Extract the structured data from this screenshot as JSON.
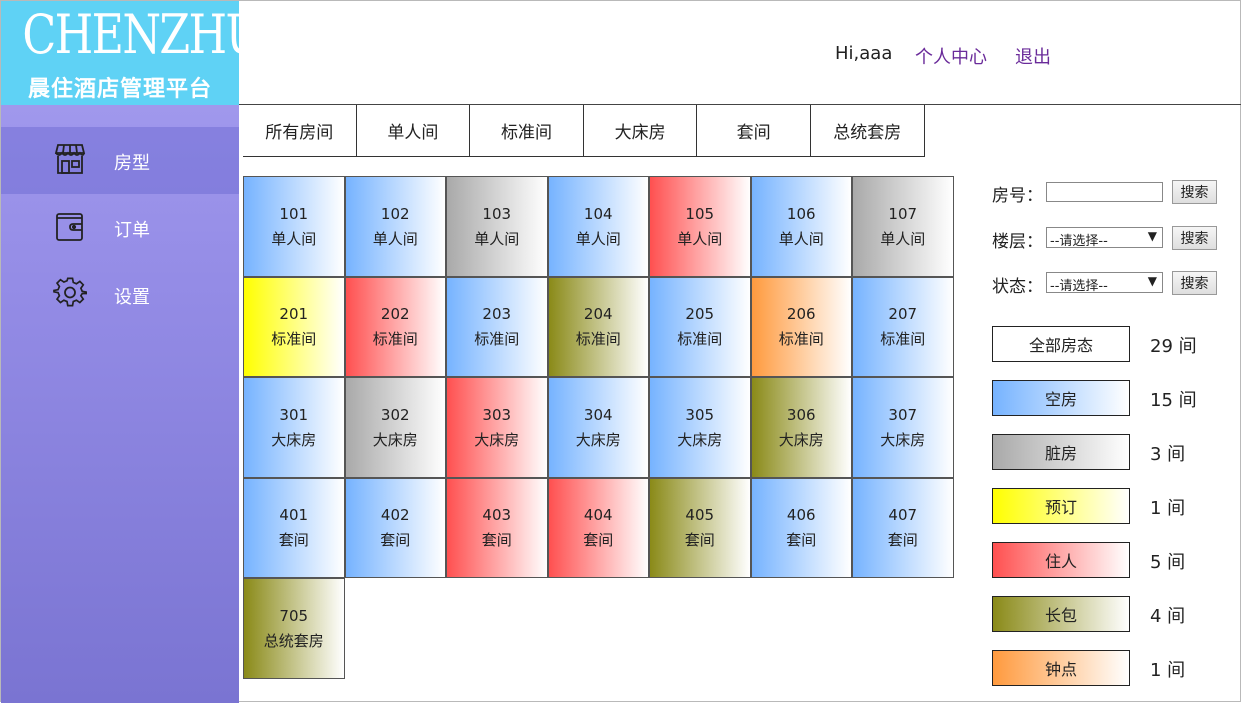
{
  "logo": {
    "title": "CHENZHU",
    "subtitle": "晨住酒店管理平台"
  },
  "sidebar": {
    "items": [
      {
        "label": "房型",
        "icon": "storefront-icon",
        "active": true
      },
      {
        "label": "订单",
        "icon": "wallet-icon",
        "active": false
      },
      {
        "label": "设置",
        "icon": "gear-icon",
        "active": false
      }
    ]
  },
  "header": {
    "greeting": "Hi,aaa",
    "profile_link": "个人中心",
    "logout_link": "退出"
  },
  "tabs": [
    "所有房间",
    "单人间",
    "标准间",
    "大床房",
    "套间",
    "总统套房"
  ],
  "rooms": [
    {
      "num": "101",
      "type": "单人间",
      "status": "empty"
    },
    {
      "num": "102",
      "type": "单人间",
      "status": "empty"
    },
    {
      "num": "103",
      "type": "单人间",
      "status": "dirty"
    },
    {
      "num": "104",
      "type": "单人间",
      "status": "empty"
    },
    {
      "num": "105",
      "type": "单人间",
      "status": "live"
    },
    {
      "num": "106",
      "type": "单人间",
      "status": "empty"
    },
    {
      "num": "107",
      "type": "单人间",
      "status": "dirty"
    },
    {
      "num": "201",
      "type": "标准间",
      "status": "booked"
    },
    {
      "num": "202",
      "type": "标准间",
      "status": "live"
    },
    {
      "num": "203",
      "type": "标准间",
      "status": "empty"
    },
    {
      "num": "204",
      "type": "标准间",
      "status": "long"
    },
    {
      "num": "205",
      "type": "标准间",
      "status": "empty"
    },
    {
      "num": "206",
      "type": "标准间",
      "status": "hour"
    },
    {
      "num": "207",
      "type": "标准间",
      "status": "empty"
    },
    {
      "num": "301",
      "type": "大床房",
      "status": "empty"
    },
    {
      "num": "302",
      "type": "大床房",
      "status": "dirty"
    },
    {
      "num": "303",
      "type": "大床房",
      "status": "live"
    },
    {
      "num": "304",
      "type": "大床房",
      "status": "empty"
    },
    {
      "num": "305",
      "type": "大床房",
      "status": "empty"
    },
    {
      "num": "306",
      "type": "大床房",
      "status": "long"
    },
    {
      "num": "307",
      "type": "大床房",
      "status": "empty"
    },
    {
      "num": "401",
      "type": "套间",
      "status": "empty"
    },
    {
      "num": "402",
      "type": "套间",
      "status": "empty"
    },
    {
      "num": "403",
      "type": "套间",
      "status": "live"
    },
    {
      "num": "404",
      "type": "套间",
      "status": "live"
    },
    {
      "num": "405",
      "type": "套间",
      "status": "long"
    },
    {
      "num": "406",
      "type": "套间",
      "status": "empty"
    },
    {
      "num": "407",
      "type": "套间",
      "status": "empty"
    },
    {
      "num": "705",
      "type": "总统套房",
      "status": "long"
    }
  ],
  "search": {
    "room_label": "房号：",
    "room_value": "",
    "floor_label": "楼层：",
    "floor_selected": "--请选择--",
    "state_label": "状态：",
    "state_selected": "--请选择--",
    "button_label": "搜索"
  },
  "legend": [
    {
      "label": "全部房态",
      "count": "29 间",
      "status": "all"
    },
    {
      "label": "空房",
      "count": "15 间",
      "status": "empty"
    },
    {
      "label": "脏房",
      "count": "3 间",
      "status": "dirty"
    },
    {
      "label": "预订",
      "count": "1 间",
      "status": "booked"
    },
    {
      "label": "住人",
      "count": "5 间",
      "status": "live"
    },
    {
      "label": "长包",
      "count": "4 间",
      "status": "long"
    },
    {
      "label": "钟点",
      "count": "1 间",
      "status": "hour"
    }
  ],
  "colors": {
    "empty": "#76b3ff",
    "dirty": "#a9a9a9",
    "booked": "#ffff00",
    "live": "#ff5050",
    "long": "#8a8a18",
    "hour": "#ff9a3e",
    "sidebar": "#948ce6",
    "logo_bg": "#5fd2f5",
    "link": "#6a2b9a"
  }
}
